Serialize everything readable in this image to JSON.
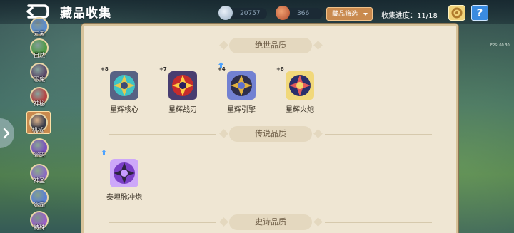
{
  "header": {
    "title": "藏品收集",
    "resource_a": "20757",
    "resource_b": "366",
    "filter_label": "藏品筛选",
    "progress_label": "收集进度：",
    "progress_value": "11/18",
    "help_label": "?"
  },
  "fps": "FPS: 60.30",
  "sidebar": {
    "items": [
      {
        "label": "元素",
        "color": "#5a8ccf"
      },
      {
        "label": "自然",
        "color": "#4f9b46"
      },
      {
        "label": "恶魔",
        "color": "#5b4a6a"
      },
      {
        "label": "神秘",
        "color": "#b64242"
      },
      {
        "label": "机械",
        "color": "#3b3f4e"
      },
      {
        "label": "光暗",
        "color": "#7a4fbf"
      },
      {
        "label": "神圣",
        "color": "#8a6ac2"
      },
      {
        "label": "冰霜",
        "color": "#5a7fd6"
      },
      {
        "label": "特殊",
        "color": "#9a5fc7"
      }
    ]
  },
  "sections": [
    {
      "title": "绝世品质",
      "items": [
        {
          "name": "星辉核心",
          "level": "+8",
          "colors": [
            "#3fc3c6",
            "#e6c94e",
            "#3c4a76"
          ]
        },
        {
          "name": "星辉战刃",
          "level": "+7",
          "colors": [
            "#c62c2c",
            "#ffcc44",
            "#2a1f5e"
          ]
        },
        {
          "name": "星辉引擎",
          "level": "+4",
          "colors": [
            "#2e2e4a",
            "#e2b13c",
            "#5c6fd1"
          ]
        },
        {
          "name": "星辉火炮",
          "level": "+8",
          "colors": [
            "#2a2f6b",
            "#e45a5a",
            "#f1d56a"
          ]
        }
      ]
    },
    {
      "title": "传说品质",
      "items": [
        {
          "name": "泰坦脉冲炮",
          "level": "",
          "colors": [
            "#7b3fc7",
            "#2c2440",
            "#c79bff"
          ]
        }
      ]
    },
    {
      "title": "史诗品质",
      "items": []
    }
  ]
}
